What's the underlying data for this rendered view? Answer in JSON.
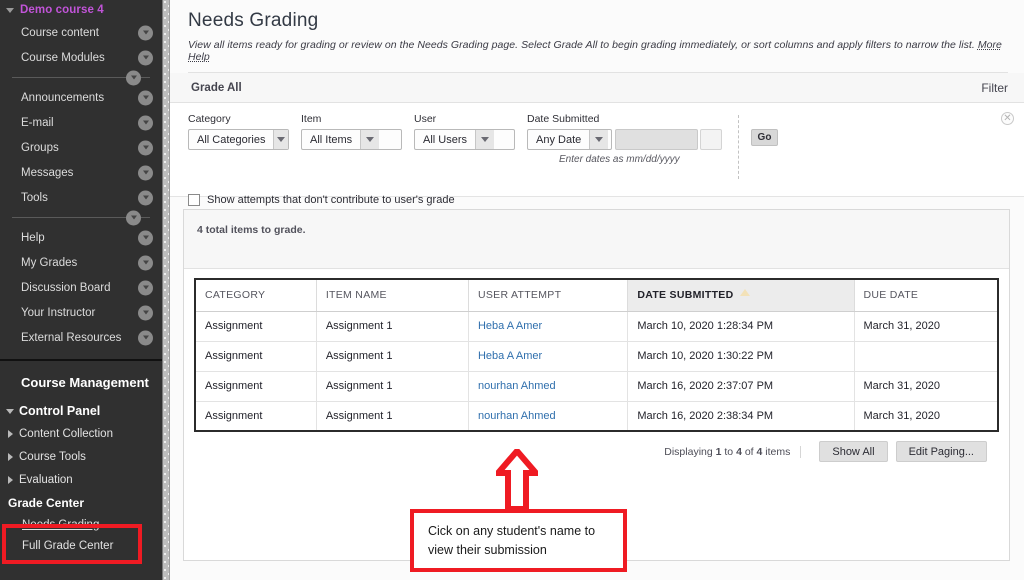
{
  "sidebar": {
    "course_title": "Demo course 4",
    "course_menu": [
      {
        "label": "Course content"
      },
      {
        "label": "Course Modules"
      }
    ],
    "course_menu_2": [
      {
        "label": "Announcements"
      },
      {
        "label": "E-mail"
      },
      {
        "label": "Groups"
      },
      {
        "label": "Messages"
      },
      {
        "label": "Tools"
      }
    ],
    "course_menu_3": [
      {
        "label": "Help"
      },
      {
        "label": "My Grades"
      },
      {
        "label": "Discussion Board"
      },
      {
        "label": "Your Instructor"
      },
      {
        "label": "External Resources"
      }
    ],
    "management_title": "Course Management",
    "control_panel": "Control Panel",
    "control_items": [
      {
        "label": "Content Collection"
      },
      {
        "label": "Course Tools"
      },
      {
        "label": "Evaluation"
      },
      {
        "label": "Grade Center"
      }
    ],
    "grade_center_children": [
      {
        "label": "Needs Grading"
      },
      {
        "label": "Full Grade Center"
      }
    ]
  },
  "header": {
    "title": "Needs Grading",
    "description": "View all items ready for grading or review on the Needs Grading page. Select Grade All to begin grading immediately, or sort columns and apply filters to narrow the list.",
    "more_help": "More Help"
  },
  "actionbar": {
    "grade_all": "Grade All",
    "filter": "Filter"
  },
  "filters": {
    "close_icon": "close-circle-icon",
    "category": {
      "label": "Category",
      "value": "All Categories"
    },
    "item": {
      "label": "Item",
      "value": "All Items"
    },
    "user": {
      "label": "User",
      "value": "All Users"
    },
    "date_submitted": {
      "label": "Date Submitted",
      "value": "Any Date"
    },
    "date_hint": "Enter dates as mm/dd/yyyy",
    "go_label": "Go",
    "checkbox_label": "Show attempts that don't contribute to user's grade"
  },
  "panel": {
    "total_items": "4 total items to grade."
  },
  "table": {
    "columns": [
      {
        "label": "CATEGORY",
        "sorted": false
      },
      {
        "label": "ITEM NAME",
        "sorted": false
      },
      {
        "label": "USER ATTEMPT",
        "sorted": false
      },
      {
        "label": "DATE SUBMITTED",
        "sorted": true,
        "sort_icon": "sort-ascending-triangle-icon"
      },
      {
        "label": "DUE DATE",
        "sorted": false
      }
    ],
    "rows": [
      {
        "category": "Assignment",
        "item_name": "Assignment 1",
        "user": "Heba A Amer",
        "date_submitted": "March 10, 2020 1:28:34 PM",
        "due_date": "March 31, 2020"
      },
      {
        "category": "Assignment",
        "item_name": "Assignment 1",
        "user": "Heba A Amer",
        "date_submitted": "March 10, 2020 1:30:22 PM",
        "due_date": ""
      },
      {
        "category": "Assignment",
        "item_name": "Assignment 1",
        "user": "nourhan Ahmed",
        "date_submitted": "March 16, 2020 2:37:07 PM",
        "due_date": "March 31, 2020"
      },
      {
        "category": "Assignment",
        "item_name": "Assignment 1",
        "user": "nourhan Ahmed",
        "date_submitted": "March 16, 2020 2:38:34 PM",
        "due_date": "March 31, 2020"
      }
    ]
  },
  "paging": {
    "displaying_prefix": "Displaying ",
    "from": "1",
    "mid": " to ",
    "to": "4",
    "of": " of ",
    "total": "4",
    "suffix": " items",
    "show_all": "Show All",
    "edit_paging": "Edit Paging..."
  },
  "annotation": {
    "line1": "Cick on any student's name to",
    "line2": "view their submission",
    "color": "#ef1b23"
  }
}
